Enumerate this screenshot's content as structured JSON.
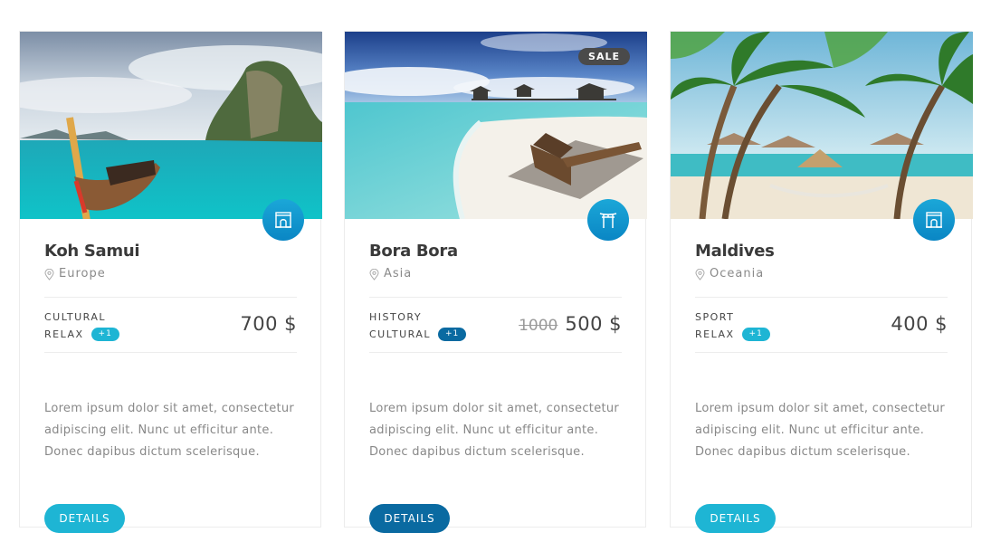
{
  "cards": [
    {
      "title": "Koh Samui",
      "location": "Europe",
      "tags": [
        "CULTURAL",
        "RELAX"
      ],
      "more_tags": "+1",
      "old_price": "",
      "price": "700 $",
      "sale": "",
      "type_icon": "arch-monument-icon",
      "description": "Lorem ipsum dolor sit amet, consectetur adipiscing elit. Nunc ut efficitur ante. Donec dapibus dictum scelerisque.",
      "button": "DETAILS"
    },
    {
      "title": "Bora Bora",
      "location": "Asia",
      "tags": [
        "HISTORY",
        "CULTURAL"
      ],
      "more_tags": "+1",
      "old_price": "1000",
      "price": "500 $",
      "sale": "SALE",
      "type_icon": "torii-gate-icon",
      "description": "Lorem ipsum dolor sit amet, consectetur adipiscing elit. Nunc ut efficitur ante. Donec dapibus dictum scelerisque.",
      "button": "DETAILS"
    },
    {
      "title": "Maldives",
      "location": "Oceania",
      "tags": [
        "SPORT",
        "RELAX"
      ],
      "more_tags": "+1",
      "old_price": "",
      "price": "400 $",
      "sale": "",
      "type_icon": "arch-monument-icon",
      "description": "Lorem ipsum dolor sit amet, consectetur adipiscing elit. Nunc ut efficitur ante. Donec dapibus dictum scelerisque.",
      "button": "DETAILS"
    }
  ],
  "colors": {
    "accent_light": "#1eb5d4",
    "accent_dark": "#0a6aa1",
    "badge_gradient_top": "#1ba7d8",
    "title": "#3a3a3a",
    "muted": "#8a8a8a"
  }
}
